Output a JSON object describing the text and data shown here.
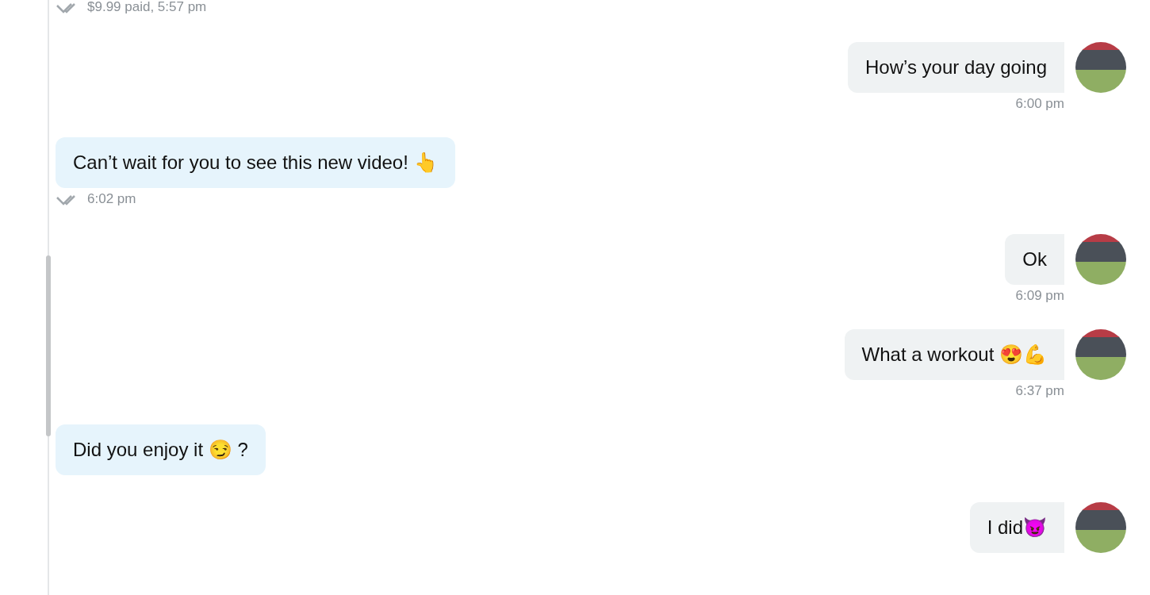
{
  "messages": [
    {
      "kind": "received",
      "meta": "$9.99 paid, 5:57 pm",
      "read": true
    },
    {
      "kind": "sent",
      "text": "How’s your day going",
      "meta": "6:00 pm"
    },
    {
      "kind": "received",
      "text": "Can’t wait for you to see this new video! 👆",
      "meta": "6:02 pm",
      "read": true
    },
    {
      "kind": "sent",
      "text": "Ok",
      "meta": "6:09 pm"
    },
    {
      "kind": "sent",
      "text": "What a workout 😍💪",
      "meta": "6:37 pm"
    },
    {
      "kind": "received",
      "text": "Did you enjoy it 😏 ?"
    },
    {
      "kind": "sent",
      "text": "I did😈"
    }
  ]
}
